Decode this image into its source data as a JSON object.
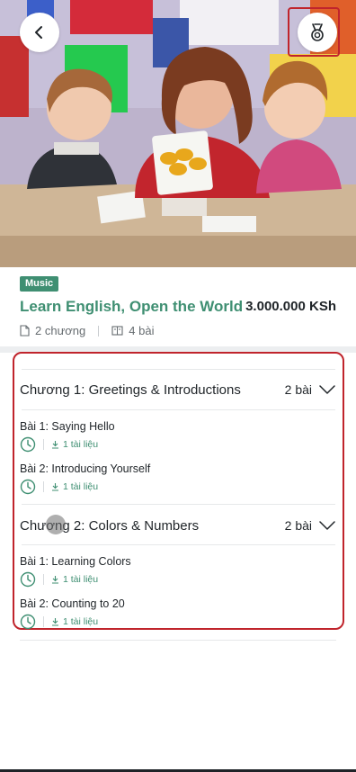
{
  "header": {
    "back_icon": "chevron-left-icon",
    "badge_icon": "medal-icon"
  },
  "course": {
    "category": "Music",
    "title": "Learn English, Open the World",
    "price": "3.000.000 KSh",
    "chapters_count": "2 chương",
    "lessons_count": "4 bài"
  },
  "chapters": [
    {
      "title": "Chương 1: Greetings & Introductions",
      "count": "2 bài",
      "lessons": [
        {
          "title": "Bài 1: Saying Hello",
          "files": "1 tài liệu"
        },
        {
          "title": "Bài 2: Introducing Yourself",
          "files": "1 tài liệu"
        }
      ]
    },
    {
      "title": "Chương 2: Colors & Numbers",
      "count": "2 bài",
      "lessons": [
        {
          "title": "Bài 1: Learning Colors",
          "files": "1 tài liệu"
        },
        {
          "title": "Bài 2: Counting to 20",
          "files": "1 tài liệu"
        }
      ]
    }
  ],
  "colors": {
    "accent": "#3f8f72",
    "highlight_border": "#c0242c"
  }
}
